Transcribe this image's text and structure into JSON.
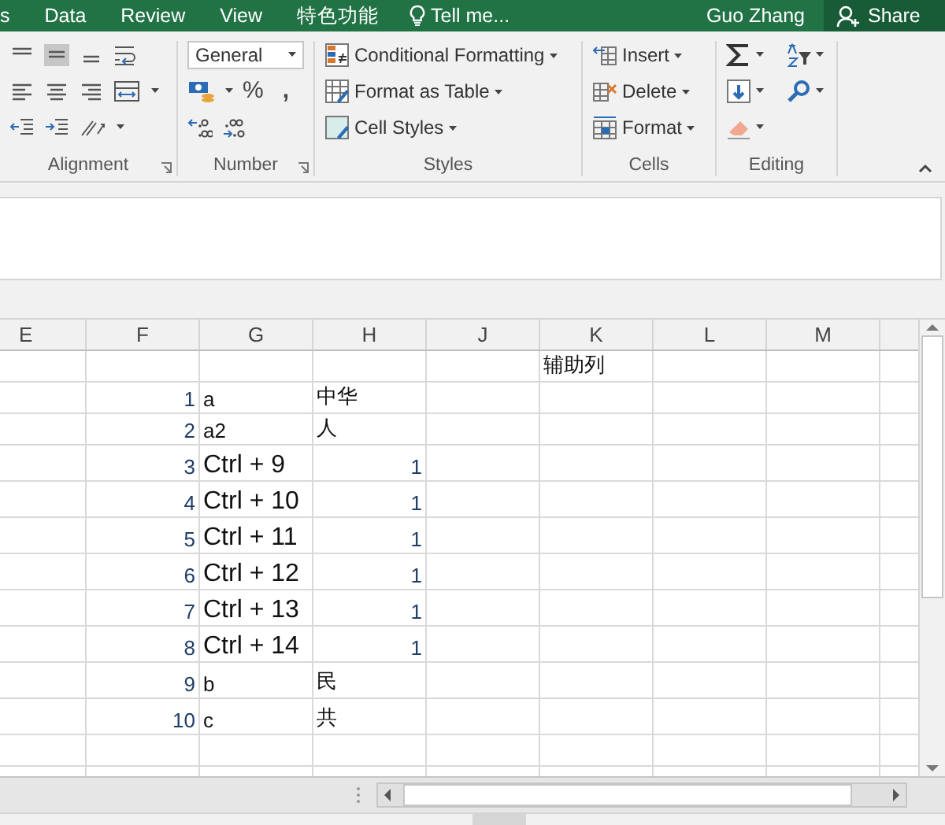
{
  "menu_tabs": [
    {
      "label": "s",
      "selected": false
    },
    {
      "label": "Data",
      "selected": false
    },
    {
      "label": "Review",
      "selected": false
    },
    {
      "label": "View",
      "selected": false
    },
    {
      "label": "特色功能",
      "selected": false
    }
  ],
  "tell_me": "Tell me...",
  "user": "Guo Zhang",
  "share": "Share",
  "ribbon": {
    "alignment": {
      "label": "Alignment",
      "middle_align_selected": true
    },
    "number": {
      "label": "Number",
      "format": "General",
      "percent": "%",
      "comma": ","
    },
    "styles": {
      "label": "Styles",
      "items": [
        {
          "label": "Conditional Formatting",
          "kind": "conditional"
        },
        {
          "label": "Format as Table",
          "kind": "table"
        },
        {
          "label": "Cell Styles",
          "kind": "cellstyles"
        }
      ]
    },
    "cells": {
      "label": "Cells",
      "items": [
        {
          "label": "Insert",
          "kind": "insert"
        },
        {
          "label": "Delete",
          "kind": "delete"
        },
        {
          "label": "Format",
          "kind": "format"
        }
      ]
    },
    "editing": {
      "label": "Editing"
    }
  },
  "columns": [
    "E",
    "F",
    "G",
    "H",
    "J",
    "K",
    "L",
    "M"
  ],
  "rows": [
    {
      "tall": false,
      "cells": {
        "K": {
          "text": "辅助列",
          "kind": "text"
        }
      }
    },
    {
      "tall": false,
      "cells": {
        "F": {
          "text": "1",
          "kind": "number"
        },
        "G": {
          "text": "a",
          "kind": "text"
        },
        "H": {
          "text": "中华",
          "kind": "text"
        }
      }
    },
    {
      "tall": false,
      "cells": {
        "F": {
          "text": "2",
          "kind": "number"
        },
        "G": {
          "text": "a2",
          "kind": "text"
        },
        "H": {
          "text": "人",
          "kind": "text"
        }
      }
    },
    {
      "tall": true,
      "cells": {
        "F": {
          "text": "3",
          "kind": "number"
        },
        "G": {
          "text": "Ctrl + 9",
          "kind": "large"
        },
        "H": {
          "text": "1",
          "kind": "number"
        }
      }
    },
    {
      "tall": true,
      "cells": {
        "F": {
          "text": "4",
          "kind": "number"
        },
        "G": {
          "text": "Ctrl + 10",
          "kind": "large"
        },
        "H": {
          "text": "1",
          "kind": "number"
        }
      }
    },
    {
      "tall": true,
      "cells": {
        "F": {
          "text": "5",
          "kind": "number"
        },
        "G": {
          "text": "Ctrl + 11",
          "kind": "large"
        },
        "H": {
          "text": "1",
          "kind": "number"
        }
      }
    },
    {
      "tall": true,
      "cells": {
        "F": {
          "text": "6",
          "kind": "number"
        },
        "G": {
          "text": "Ctrl + 12",
          "kind": "large"
        },
        "H": {
          "text": "1",
          "kind": "number"
        }
      }
    },
    {
      "tall": true,
      "cells": {
        "F": {
          "text": "7",
          "kind": "number"
        },
        "G": {
          "text": "Ctrl + 13",
          "kind": "large"
        },
        "H": {
          "text": "1",
          "kind": "number"
        }
      }
    },
    {
      "tall": true,
      "cells": {
        "F": {
          "text": "8",
          "kind": "number"
        },
        "G": {
          "text": "Ctrl + 14",
          "kind": "large"
        },
        "H": {
          "text": "1",
          "kind": "number"
        }
      }
    },
    {
      "tall": true,
      "cells": {
        "F": {
          "text": "9",
          "kind": "number"
        },
        "G": {
          "text": "b",
          "kind": "text"
        },
        "H": {
          "text": "民",
          "kind": "text"
        }
      }
    },
    {
      "tall": true,
      "cells": {
        "F": {
          "text": "10",
          "kind": "number"
        },
        "G": {
          "text": "c",
          "kind": "text"
        },
        "H": {
          "text": "共",
          "kind": "text"
        }
      }
    },
    {
      "tall": false,
      "cells": {}
    },
    {
      "tall": false,
      "cells": {}
    }
  ]
}
